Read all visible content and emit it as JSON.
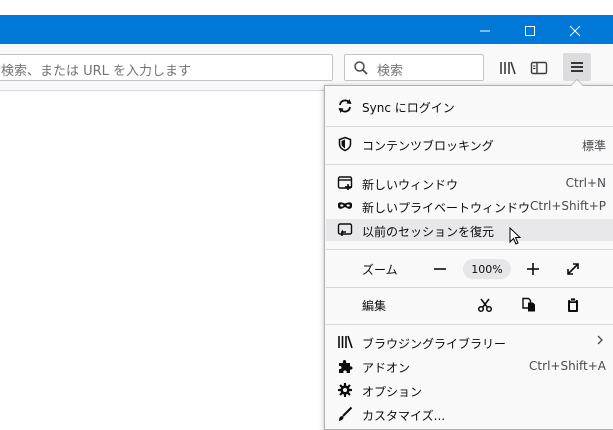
{
  "window": {
    "minimize_label": "—",
    "maximize_label": "☐",
    "close_label": "✕"
  },
  "toolbar": {
    "url_placeholder": "検索、または URL を入力します",
    "search_placeholder": "検索"
  },
  "menu": {
    "sync": {
      "label": "Sync にログイン"
    },
    "content_blocking": {
      "label": "コンテンツブロッキング",
      "value": "標準"
    },
    "new_window": {
      "label": "新しいウィンドウ",
      "shortcut": "Ctrl+N"
    },
    "new_private_window": {
      "label": "新しいプライベートウィンドウ",
      "shortcut": "Ctrl+Shift+P"
    },
    "restore_session": {
      "label": "以前のセッションを復元"
    },
    "zoom": {
      "label": "ズーム",
      "value": "100%"
    },
    "edit": {
      "label": "編集"
    },
    "library": {
      "label": "ブラウジングライブラリー"
    },
    "addons": {
      "label": "アドオン",
      "shortcut": "Ctrl+Shift+A"
    },
    "options": {
      "label": "オプション"
    },
    "customize": {
      "label": "カスタマイズ..."
    }
  },
  "colors": {
    "titlebar": "#0078d7",
    "panel": "#f9f9fa",
    "hover": "#e8e8ea"
  }
}
